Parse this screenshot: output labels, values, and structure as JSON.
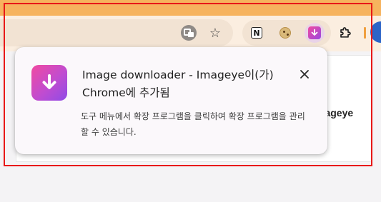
{
  "colors": {
    "title_bar": "#f6b35e",
    "toolbar": "#fbeee0",
    "annotation_frame": "#e81818",
    "extension_brand_start": "#f14aa0",
    "extension_brand_end": "#8f4be6"
  },
  "toolbar": {
    "icons": [
      "translate-icon",
      "bookmark-star-icon",
      "notion-extension-icon",
      "cookie-extension-icon",
      "imageeye-extension-icon",
      "extensions-puzzle-icon"
    ],
    "notion_glyph": "N"
  },
  "page": {
    "partial_text": "mageye"
  },
  "popup": {
    "title": "Image downloader - Imageye이(가) Chrome에 추가됨",
    "body": "도구 메뉴에서 확장 프로그램을 클릭하여 확장 프로그램을 관리할 수 있습니다.",
    "close_symbol": "✕"
  }
}
